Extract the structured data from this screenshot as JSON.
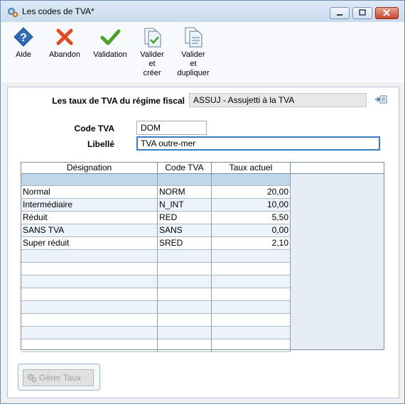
{
  "window": {
    "title": "Les codes de TVA*"
  },
  "toolbar": {
    "aide": "Aide",
    "abandon": "Abandon",
    "validation": "Validation",
    "valider_creer": [
      "Valider",
      "et",
      "créer"
    ],
    "valider_dupliquer": [
      "Valider",
      "et",
      "dupliquer"
    ]
  },
  "form": {
    "regime_label": "Les taux de TVA du régime fiscal",
    "regime_value": "ASSUJ - Assujetti à la TVA",
    "code_label": "Code TVA",
    "code_value": "DOM",
    "libelle_label": "Libellé",
    "libelle_value": "TVA outre-mer"
  },
  "table": {
    "headers": [
      "Désignation",
      "Code TVA",
      "Taux actuel"
    ],
    "rows": [
      [
        "Normal",
        "NORM",
        "20,00"
      ],
      [
        "Intermédiaire",
        "N_INT",
        "10,00"
      ],
      [
        "Réduit",
        "RED",
        "5,50"
      ],
      [
        "SANS TVA",
        "SANS",
        "0,00"
      ],
      [
        "Super réduit",
        "SRED",
        "2,10"
      ]
    ]
  },
  "footer": {
    "gerer_taux": "Gérer Taux"
  },
  "colors": {
    "accent": "#3a7cc4",
    "header_row": "#c2d6ea",
    "alt_row": "#edf3fa"
  }
}
